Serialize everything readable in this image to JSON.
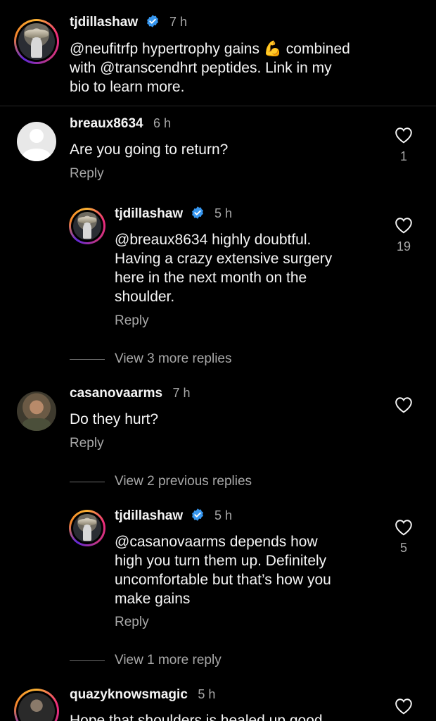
{
  "caption": {
    "username": "tjdillashaw",
    "time": "7 h",
    "text_line1": "@neufitrfp hypertrophy gains 💪 combined",
    "text_line2": "with @transcendhrt peptides. Link in my",
    "text_line3": "bio to learn more."
  },
  "comment1": {
    "username": "breaux8634",
    "time": "6 h",
    "text": "Are you going to return?",
    "reply_label": "Reply",
    "likes": "1"
  },
  "reply1": {
    "username": "tjdillashaw",
    "time": "5 h",
    "line1": "@breaux8634 highly doubtful.",
    "line2": "Having a crazy extensive surgery",
    "line3": "here in the next month on the",
    "line4": "shoulder.",
    "reply_label": "Reply",
    "likes": "19"
  },
  "view_more_1": "View 3 more replies",
  "comment2": {
    "username": "casanovaarms",
    "time": "7 h",
    "text": "Do they hurt?",
    "reply_label": "Reply"
  },
  "view_previous_2": "View 2 previous replies",
  "reply2": {
    "username": "tjdillashaw",
    "time": "5 h",
    "line1": "@casanovaarms depends how",
    "line2": "high you turn them up. Definitely",
    "line3": "uncomfortable but that’s how you",
    "line4": "make gains",
    "reply_label": "Reply",
    "likes": "5"
  },
  "view_more_2": "View 1 more reply",
  "comment3": {
    "username": "quazyknowsmagic",
    "time": "5 h",
    "text_partial": "Hope that shoulders is healed up good"
  },
  "colors": {
    "background": "#000000",
    "text": "#f5f5f5",
    "secondary": "#a8a8a8",
    "verified": "#3797f0"
  },
  "icons": {
    "verified": "verified-badge-icon",
    "like": "heart-outline-icon"
  }
}
